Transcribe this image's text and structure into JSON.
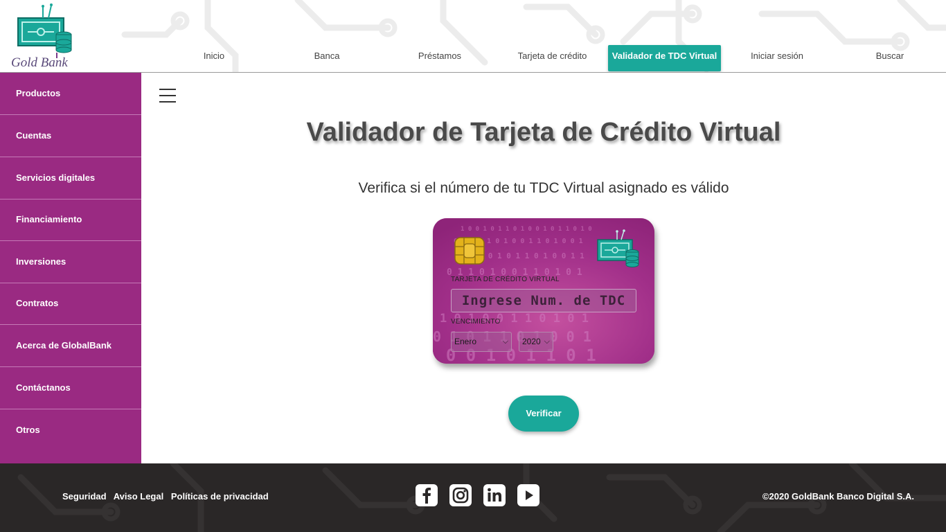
{
  "brand": {
    "name": "Gold Bank"
  },
  "nav": {
    "items": [
      {
        "label": "Inicio"
      },
      {
        "label": "Banca"
      },
      {
        "label": "Préstamos"
      },
      {
        "label": "Tarjeta de crédito"
      },
      {
        "label": "Validador de TDC Virtual",
        "active": true
      },
      {
        "label": "Iniciar sesión"
      },
      {
        "label": "Buscar"
      }
    ]
  },
  "sidebar": {
    "items": [
      {
        "label": "Productos"
      },
      {
        "label": "Cuentas"
      },
      {
        "label": "Servicios digitales"
      },
      {
        "label": "Financiamiento"
      },
      {
        "label": "Inversiones"
      },
      {
        "label": "Contratos"
      },
      {
        "label": "Acerca de GlobalBank"
      },
      {
        "label": "Contáctanos"
      },
      {
        "label": "Otros"
      }
    ]
  },
  "main": {
    "title": "Validador de Tarjeta de Crédito Virtual",
    "subtitle": "Verifica si el número de tu TDC Virtual asignado es válido",
    "card": {
      "number_label": "TARJETA DE CRÉDITO VIRTUAL",
      "number_value": "",
      "number_placeholder": "Ingrese Num. de TDC",
      "expiry_label": "VENCIMIENTO",
      "month_value": "Enero",
      "year_value": "2020"
    },
    "verify_label": "Verificar"
  },
  "footer": {
    "links": [
      "Seguridad",
      "Aviso Legal",
      "Políticas de privacidad"
    ],
    "social": [
      {
        "icon": "facebook-icon"
      },
      {
        "icon": "instagram-icon"
      },
      {
        "icon": "linkedin-icon"
      },
      {
        "icon": "youtube-icon"
      }
    ],
    "copyright": "©2020 GoldBank Banco Digital S.A."
  },
  "colors": {
    "accent": "#1aa89a",
    "sidebar": "#9a2a82",
    "footer": "#2a2727",
    "card": "#9d2a85"
  }
}
